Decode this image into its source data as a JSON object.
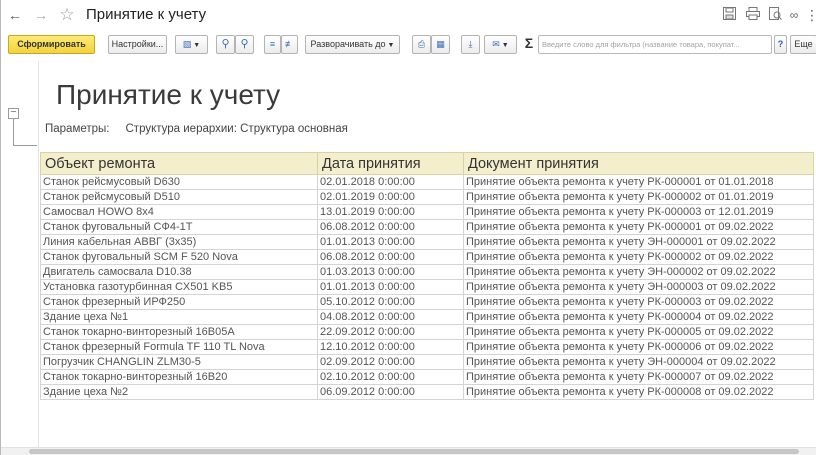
{
  "window": {
    "title": "Принятие к учету",
    "back_glyph": "←",
    "forward_glyph": "→",
    "star_glyph": "☆",
    "link_glyph": "🔗",
    "more_glyph": "⋮"
  },
  "toolbar": {
    "generate_label": "Сформировать",
    "settings_label": "Настройки...",
    "expand_label": "Разворачивать до",
    "search_placeholder": "Введите слово для фильтра (название товара, покупат...",
    "help_label": "?",
    "more_label": "Еще",
    "sum_glyph": "Σ"
  },
  "report": {
    "title": "Принятие к учету",
    "params_label": "Параметры:",
    "params_value": "Структура иерархии: Структура основная"
  },
  "table": {
    "columns": [
      "Объект ремонта",
      "Дата принятия",
      "Документ принятия"
    ],
    "rows": [
      [
        "Станок рейсмусовый D630",
        "02.01.2018 0:00:00",
        "Принятие объекта ремонта к учету РК-000001 от 01.01.2018"
      ],
      [
        "Станок рейсмусовый D510",
        "02.01.2019 0:00:00",
        "Принятие объекта ремонта к учету РК-000002 от 01.01.2019"
      ],
      [
        "Самосвал HOWO 8х4",
        "13.01.2019 0:00:00",
        "Принятие объекта ремонта к учету РК-000003 от 12.01.2019"
      ],
      [
        "Станок фуговальный СФ4-1Т",
        "06.08.2012 0:00:00",
        "Принятие объекта ремонта к учету РК-000001 от 09.02.2022"
      ],
      [
        "Линия кабельная АВВГ (3х35)",
        "01.01.2013 0:00:00",
        "Принятие объекта ремонта к учету ЭН-000001 от 09.02.2022"
      ],
      [
        "Станок фуговальный SCM F 520 Nova",
        "06.08.2012 0:00:00",
        "Принятие объекта ремонта к учету РК-000002 от 09.02.2022"
      ],
      [
        "Двигатель самосвала D10.38",
        "01.03.2013 0:00:00",
        "Принятие объекта ремонта к учету ЭН-000002 от 09.02.2022"
      ],
      [
        "Установка газотурбинная CX501 KB5",
        "01.01.2013 0:00:00",
        "Принятие объекта ремонта к учету ЭН-000003 от 09.02.2022"
      ],
      [
        "Станок фрезерный ИРФ250",
        "05.10.2012 0:00:00",
        "Принятие объекта ремонта к учету РК-000003 от 09.02.2022"
      ],
      [
        "Здание цеха №1",
        "04.08.2012 0:00:00",
        "Принятие объекта ремонта к учету РК-000004 от 09.02.2022"
      ],
      [
        "Станок токарно-винторезный 16В05А",
        "22.09.2012 0:00:00",
        "Принятие объекта ремонта к учету РК-000005 от 09.02.2022"
      ],
      [
        "Станок фрезерный Formula TF 110 TL Nova",
        "12.10.2012 0:00:00",
        "Принятие объекта ремонта к учету РК-000006 от 09.02.2022"
      ],
      [
        "Погрузчик CHANGLIN ZLM30-5",
        "02.09.2012 0:00:00",
        "Принятие объекта ремонта к учету ЭН-000004 от 09.02.2022"
      ],
      [
        "Станок токарно-винторезный 16В20",
        "02.10.2012 0:00:00",
        "Принятие объекта ремонта к учету РК-000007 от 09.02.2022"
      ],
      [
        "Здание цеха №2",
        "06.09.2012 0:00:00",
        "Принятие объекта ремонта к учету РК-000008 от 09.02.2022"
      ]
    ]
  },
  "icons": {
    "nav_back": "arrow-left-icon",
    "nav_forward": "arrow-right-icon",
    "favorite": "star-icon",
    "save": "save-icon",
    "print": "print-icon",
    "preview": "preview-icon",
    "link": "link-icon",
    "more": "more-icon"
  }
}
